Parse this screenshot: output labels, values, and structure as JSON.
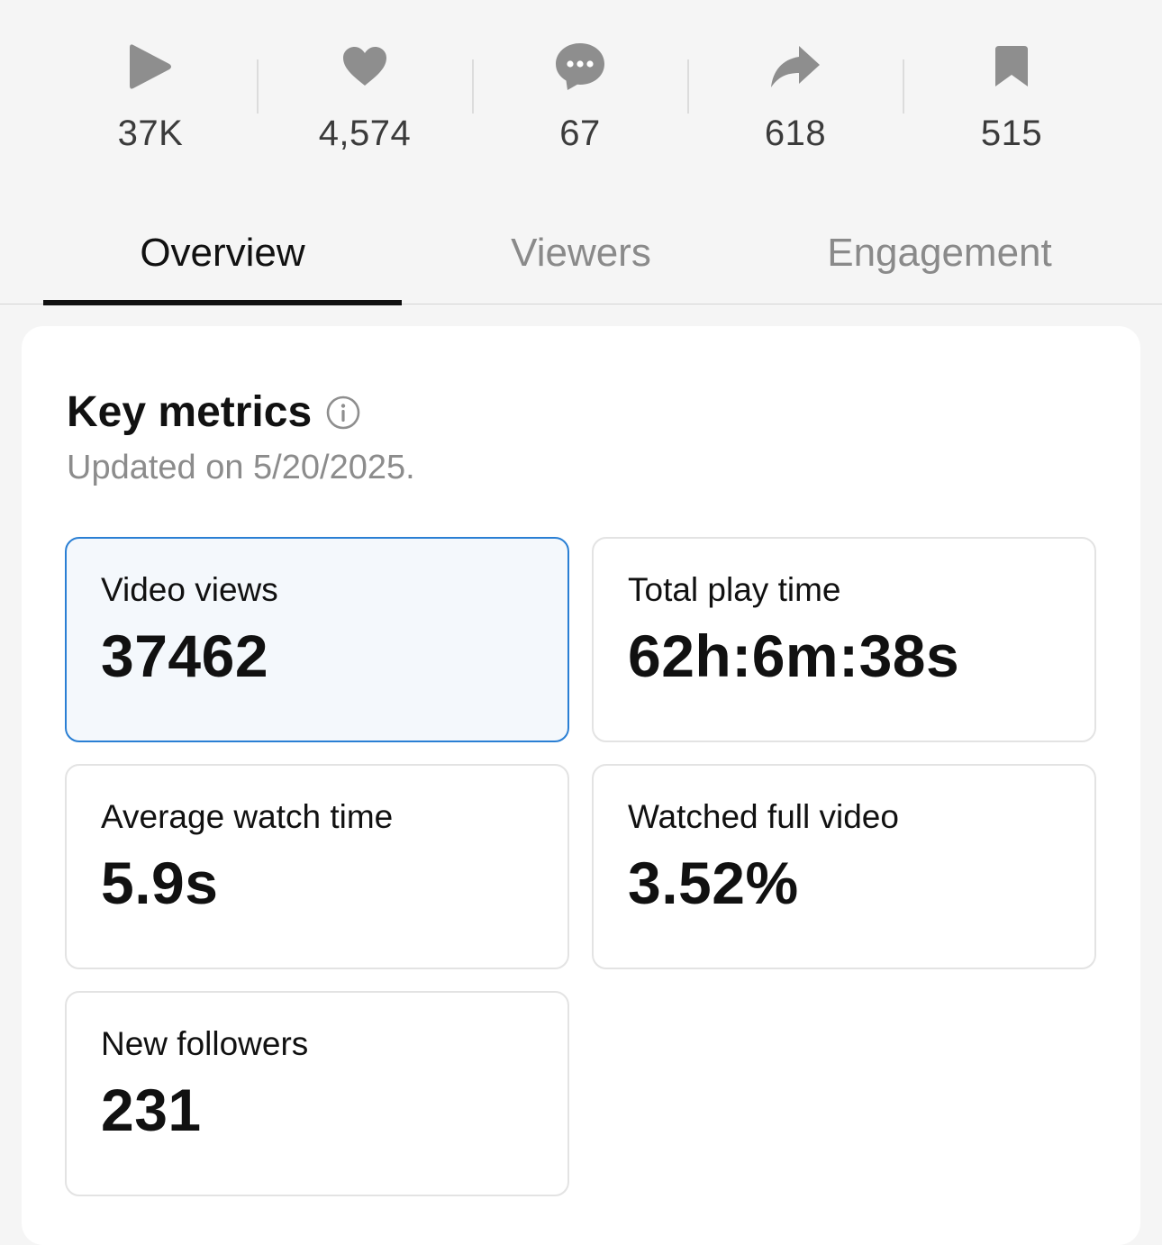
{
  "stats": [
    {
      "icon": "play-icon",
      "value": "37K"
    },
    {
      "icon": "heart-icon",
      "value": "4,574"
    },
    {
      "icon": "comment-icon",
      "value": "67"
    },
    {
      "icon": "share-icon",
      "value": "618"
    },
    {
      "icon": "bookmark-icon",
      "value": "515"
    }
  ],
  "tabs": [
    {
      "label": "Overview",
      "active": true
    },
    {
      "label": "Viewers",
      "active": false
    },
    {
      "label": "Engagement",
      "active": false
    }
  ],
  "key_metrics": {
    "title": "Key metrics",
    "info_icon": "info-icon",
    "updated": "Updated on 5/20/2025.",
    "metrics": [
      {
        "label": "Video views",
        "value": "37462",
        "selected": true
      },
      {
        "label": "Total play time",
        "value": "62h:6m:38s",
        "selected": false
      },
      {
        "label": "Average watch time",
        "value": "5.9s",
        "selected": false
      },
      {
        "label": "Watched full video",
        "value": "3.52%",
        "selected": false
      },
      {
        "label": "New followers",
        "value": "231",
        "selected": false
      }
    ]
  },
  "colors": {
    "icon_gray": "#8e8e8e",
    "selected_border": "#2a7fd4",
    "selected_bg": "#f4f8fc"
  }
}
